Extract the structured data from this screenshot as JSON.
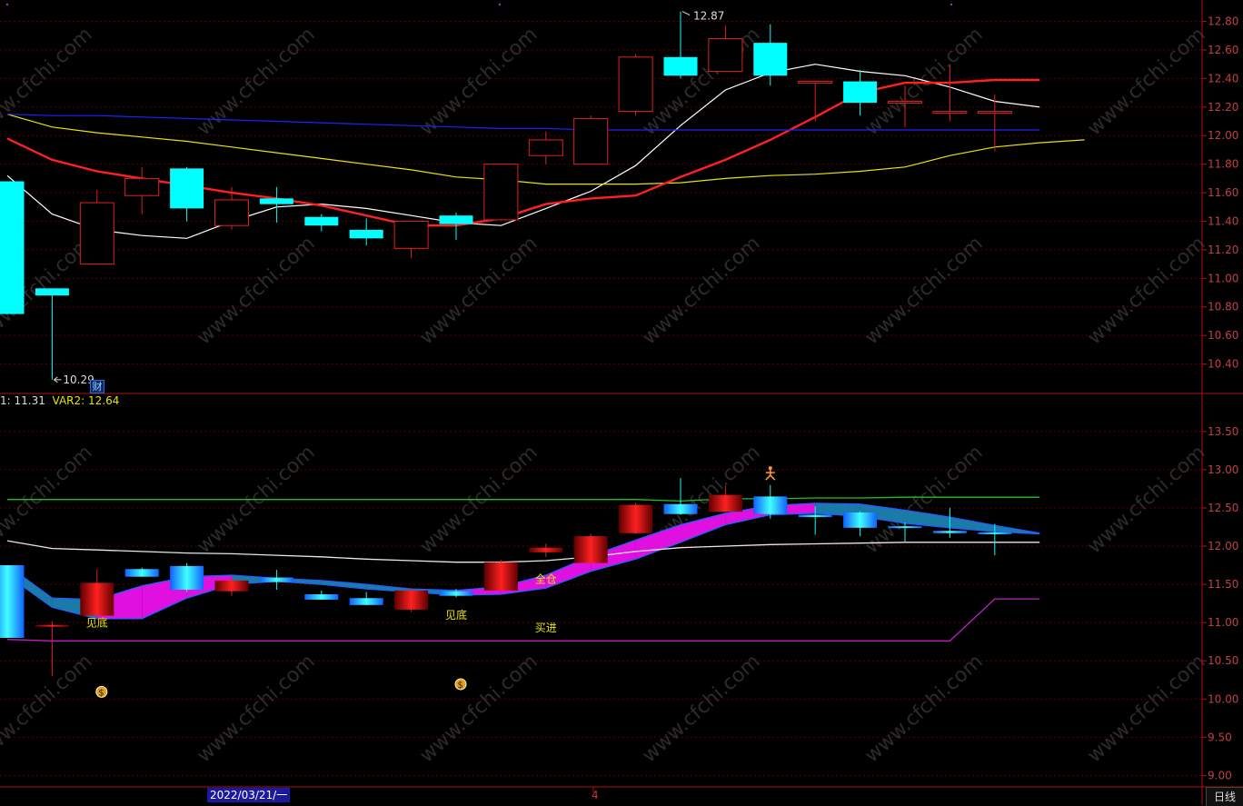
{
  "colors": {
    "bg": "#000000",
    "grid": "#5a0000",
    "axis": "#b01010",
    "up": "#e02020",
    "down": "#00ffff",
    "ma5": "#ffffff",
    "ma10": "#e6e600",
    "ma20": "#ff2020",
    "ma60": "#2020ff",
    "tick_text": "#c04040",
    "var2": "#e6e600"
  },
  "main_panel": {
    "high_label": "12.87",
    "low_label": "10.29",
    "finance_badge": "财",
    "y_ticks": [
      "12.80",
      "12.60",
      "12.40",
      "12.20",
      "12.00",
      "11.80",
      "11.60",
      "11.40",
      "11.20",
      "11.00",
      "10.80",
      "10.60",
      "10.40"
    ]
  },
  "indicator_panel": {
    "title_prefix": "1: 11.31",
    "title_var2": "VAR2: 12.64",
    "y_ticks": [
      "13.50",
      "13.00",
      "12.50",
      "12.00",
      "11.50",
      "11.00",
      "10.50",
      "10.00",
      "9.50",
      "9.00"
    ],
    "signals": [
      {
        "text": "见底",
        "icon": "money-bag-icon"
      },
      {
        "text": "见底",
        "icon": "money-bag-icon"
      },
      {
        "text": "全仓"
      },
      {
        "text": "买进"
      }
    ],
    "runner_icon": "runner-icon"
  },
  "footer": {
    "date": "2022/03/21/一",
    "month": "4",
    "period_tab": "日线"
  },
  "watermark": "www.cfchi.com",
  "chart_data": [
    {
      "type": "candlestick",
      "ylim": [
        10.2,
        12.95
      ],
      "candles": [
        {
          "o": 11.68,
          "h": 11.68,
          "l": 10.75,
          "c": 10.75
        },
        {
          "o": 10.93,
          "h": 10.93,
          "l": 10.29,
          "c": 10.88
        },
        {
          "o": 11.1,
          "h": 11.62,
          "l": 11.1,
          "c": 11.53
        },
        {
          "o": 11.58,
          "h": 11.78,
          "l": 11.45,
          "c": 11.7
        },
        {
          "o": 11.77,
          "h": 11.78,
          "l": 11.4,
          "c": 11.49
        },
        {
          "o": 11.37,
          "h": 11.64,
          "l": 11.34,
          "c": 11.55
        },
        {
          "o": 11.56,
          "h": 11.64,
          "l": 11.39,
          "c": 11.52
        },
        {
          "o": 11.43,
          "h": 11.45,
          "l": 11.33,
          "c": 11.37
        },
        {
          "o": 11.34,
          "h": 11.42,
          "l": 11.23,
          "c": 11.28
        },
        {
          "o": 11.21,
          "h": 11.4,
          "l": 11.14,
          "c": 11.4
        },
        {
          "o": 11.44,
          "h": 11.46,
          "l": 11.27,
          "c": 11.38
        },
        {
          "o": 11.41,
          "h": 11.8,
          "l": 11.41,
          "c": 11.8
        },
        {
          "o": 11.86,
          "h": 12.03,
          "l": 11.8,
          "c": 11.97
        },
        {
          "o": 11.8,
          "h": 12.14,
          "l": 11.8,
          "c": 12.12
        },
        {
          "o": 12.17,
          "h": 12.57,
          "l": 12.14,
          "c": 12.55
        },
        {
          "o": 12.55,
          "h": 12.87,
          "l": 12.4,
          "c": 12.42
        },
        {
          "o": 12.45,
          "h": 12.77,
          "l": 12.45,
          "c": 12.68
        },
        {
          "o": 12.65,
          "h": 12.78,
          "l": 12.35,
          "c": 12.42
        },
        {
          "o": 12.38,
          "h": 12.38,
          "l": 12.1,
          "c": 12.38
        },
        {
          "o": 12.38,
          "h": 12.46,
          "l": 12.14,
          "c": 12.23
        },
        {
          "o": 12.24,
          "h": 12.35,
          "l": 12.06,
          "c": 12.24
        },
        {
          "o": 12.17,
          "h": 12.5,
          "l": 12.1,
          "c": 12.17
        },
        {
          "o": 12.17,
          "h": 12.29,
          "l": 11.89,
          "c": 12.17
        }
      ],
      "series": [
        {
          "name": "MA5",
          "values": [
            11.72,
            11.45,
            11.34,
            11.3,
            11.28,
            11.4,
            11.5,
            11.52,
            11.49,
            11.44,
            11.39,
            11.37,
            11.49,
            11.61,
            11.79,
            12.07,
            12.32,
            12.44,
            12.5,
            12.45,
            12.42,
            12.34,
            12.24,
            12.2
          ]
        },
        {
          "name": "MA10",
          "values": [
            12.15,
            12.06,
            12.02,
            11.99,
            11.96,
            11.92,
            11.88,
            11.84,
            11.8,
            11.76,
            11.71,
            11.69,
            11.66,
            11.66,
            11.66,
            11.67,
            11.7,
            11.72,
            11.73,
            11.75,
            11.78,
            11.86,
            11.92,
            11.95,
            11.97
          ]
        },
        {
          "name": "MA20",
          "values": [
            11.98,
            11.83,
            11.75,
            11.7,
            11.65,
            11.6,
            11.56,
            11.51,
            11.44,
            11.37,
            11.37,
            11.42,
            11.52,
            11.56,
            11.58,
            11.71,
            11.83,
            11.97,
            12.13,
            12.3,
            12.37,
            12.37,
            12.39,
            12.39
          ]
        },
        {
          "name": "MA60",
          "values": [
            12.15,
            12.14,
            12.14,
            12.13,
            12.12,
            12.11,
            12.1,
            12.09,
            12.08,
            12.07,
            12.06,
            12.05,
            12.05,
            12.04,
            12.04,
            12.04,
            12.04,
            12.04,
            12.04,
            12.04,
            12.04,
            12.04,
            12.04,
            12.04
          ]
        }
      ]
    },
    {
      "type": "candlestick",
      "ylim": [
        8.85,
        13.95
      ],
      "candles": [
        {
          "o": 11.75,
          "h": 11.75,
          "l": 10.8,
          "c": 10.8
        },
        {
          "o": 10.95,
          "h": 11.02,
          "l": 10.3,
          "c": 10.97
        },
        {
          "o": 11.09,
          "h": 11.7,
          "l": 11.09,
          "c": 11.52
        },
        {
          "o": 11.7,
          "h": 11.72,
          "l": 11.61,
          "c": 11.6
        },
        {
          "o": 11.74,
          "h": 11.78,
          "l": 11.4,
          "c": 11.43
        },
        {
          "o": 11.41,
          "h": 11.58,
          "l": 11.35,
          "c": 11.55
        },
        {
          "o": 11.59,
          "h": 11.69,
          "l": 11.43,
          "c": 11.53
        },
        {
          "o": 11.37,
          "h": 11.42,
          "l": 11.3,
          "c": 11.3
        },
        {
          "o": 11.32,
          "h": 11.4,
          "l": 11.23,
          "c": 11.23
        },
        {
          "o": 11.17,
          "h": 11.45,
          "l": 11.14,
          "c": 11.42
        },
        {
          "o": 11.41,
          "h": 11.44,
          "l": 11.33,
          "c": 11.35
        },
        {
          "o": 11.42,
          "h": 11.82,
          "l": 11.42,
          "c": 11.79
        },
        {
          "o": 11.92,
          "h": 12.03,
          "l": 11.86,
          "c": 11.98
        },
        {
          "o": 11.78,
          "h": 12.16,
          "l": 11.77,
          "c": 12.13
        },
        {
          "o": 12.17,
          "h": 12.57,
          "l": 12.16,
          "c": 12.54
        },
        {
          "o": 12.55,
          "h": 12.89,
          "l": 12.41,
          "c": 12.42
        },
        {
          "o": 12.45,
          "h": 12.79,
          "l": 12.45,
          "c": 12.67
        },
        {
          "o": 12.65,
          "h": 12.8,
          "l": 12.36,
          "c": 12.42
        },
        {
          "o": 12.41,
          "h": 12.52,
          "l": 12.15,
          "c": 12.38
        },
        {
          "o": 12.44,
          "h": 12.46,
          "l": 12.13,
          "c": 12.24
        },
        {
          "o": 12.26,
          "h": 12.31,
          "l": 12.06,
          "c": 12.24
        },
        {
          "o": 12.2,
          "h": 12.5,
          "l": 12.11,
          "c": 12.17
        },
        {
          "o": 12.18,
          "h": 12.29,
          "l": 11.88,
          "c": 12.16
        }
      ],
      "series": [
        {
          "name": "upper",
          "values": [
            12.61,
            12.61,
            12.61,
            12.61,
            12.61,
            12.61,
            12.61,
            12.61,
            12.61,
            12.61,
            12.61,
            12.61,
            12.61,
            12.61,
            12.61,
            12.59,
            12.62,
            12.62,
            12.63,
            12.63,
            12.64,
            12.64,
            12.64,
            12.64
          ]
        },
        {
          "name": "band_top",
          "values": [
            11.75,
            11.32,
            11.3,
            11.48,
            11.6,
            11.62,
            11.58,
            11.55,
            11.5,
            11.44,
            11.42,
            11.47,
            11.62,
            11.87,
            12.08,
            12.28,
            12.43,
            12.53,
            12.56,
            12.55,
            12.47,
            12.38,
            12.27,
            12.17
          ]
        },
        {
          "name": "band_bottom",
          "values": [
            11.62,
            11.2,
            11.05,
            11.05,
            11.32,
            11.5,
            11.54,
            11.5,
            11.44,
            11.4,
            11.36,
            11.37,
            11.45,
            11.67,
            11.83,
            12.05,
            12.28,
            12.41,
            12.43,
            12.39,
            12.3,
            12.24,
            12.19,
            12.16
          ]
        },
        {
          "name": "lower",
          "values": [
            10.78,
            10.76,
            10.76,
            10.76,
            10.76,
            10.76,
            10.76,
            10.76,
            10.76,
            10.76,
            10.76,
            10.76,
            10.76,
            10.76,
            10.76,
            10.76,
            10.76,
            10.76,
            10.76,
            10.76,
            10.76,
            10.76,
            11.31,
            11.31
          ]
        },
        {
          "name": "support",
          "values": [
            12.07,
            11.97,
            11.95,
            11.93,
            11.91,
            11.9,
            11.88,
            11.86,
            11.83,
            11.81,
            11.79,
            11.79,
            11.81,
            11.86,
            11.93,
            11.98,
            12.0,
            12.02,
            12.03,
            12.04,
            12.05,
            12.05,
            12.05,
            12.05
          ]
        }
      ]
    }
  ]
}
